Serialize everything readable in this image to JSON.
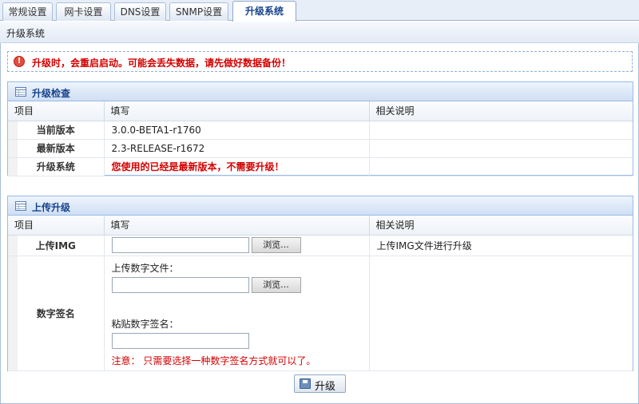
{
  "tabs": [
    {
      "label": "常规设置",
      "active": false
    },
    {
      "label": "网卡设置",
      "active": false
    },
    {
      "label": "DNS设置",
      "active": false
    },
    {
      "label": "SNMP设置",
      "active": false
    },
    {
      "label": "升级系统",
      "active": true
    }
  ],
  "page": {
    "title": "升级系统"
  },
  "warning": {
    "icon": "exclamation-icon",
    "text": "升级时，会重启启动。可能会丢失数据，请先做好数据备份！"
  },
  "columns": {
    "item": "项目",
    "fill": "填写",
    "desc": "相关说明"
  },
  "check_panel": {
    "title": "升级检查",
    "rows": [
      {
        "label": "当前版本",
        "value": "3.0.0-BETA1-r1760",
        "desc": ""
      },
      {
        "label": "最新版本",
        "value": "2.3-RELEASE-r1672",
        "desc": ""
      },
      {
        "label": "升级系统",
        "value": "您使用的已经是最新版本，不需要升级！",
        "desc": ""
      }
    ]
  },
  "upload_panel": {
    "title": "上传升级",
    "img_label": "上传IMG",
    "img_desc": "上传IMG文件进行升级",
    "browse": "浏览...",
    "sig_label": "数字签名",
    "sig_file_label": "上传数字文件：",
    "sig_paste_label": "粘贴数字签名：",
    "note": "注意： 只需要选择一种数字签名方式就可以了。",
    "upgrade_button": "升级"
  },
  "colors": {
    "accent": "#15428b",
    "warning": "#d40000",
    "border": "#99bbe8"
  }
}
